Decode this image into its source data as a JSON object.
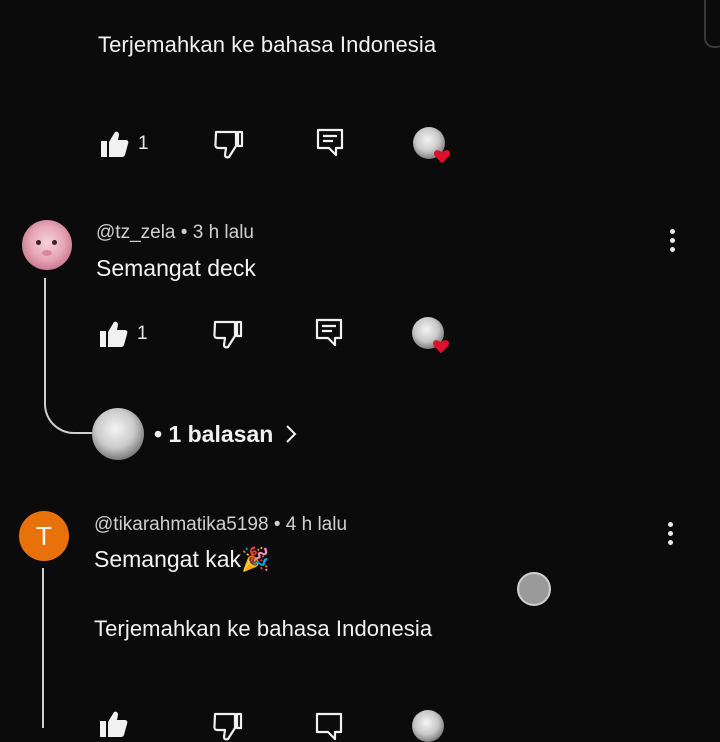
{
  "comment_top": {
    "translate_label": "Terjemahkan ke bahasa Indonesia",
    "like_count": "1"
  },
  "comment_1": {
    "handle": "@tz_zela",
    "separator": "•",
    "time": "3 h lalu",
    "text": "Semangat deck",
    "like_count": "1",
    "replies_label": "• 1 balasan"
  },
  "comment_2": {
    "avatar_letter": "T",
    "handle": "@tikarahmatika5198",
    "separator": "•",
    "time": "4 h lalu",
    "text": "Semangat kak",
    "emoji": "🎉",
    "translate_label": "Terjemahkan ke bahasa Indonesia"
  },
  "colors": {
    "background": "#0b0b0b",
    "heart": "#e0102a",
    "avatar_orange": "#e8710a"
  },
  "icons": [
    "like-icon",
    "dislike-icon",
    "reply-icon",
    "heart-icon",
    "more-vert-icon",
    "chevron-right-icon",
    "touch-indicator"
  ]
}
